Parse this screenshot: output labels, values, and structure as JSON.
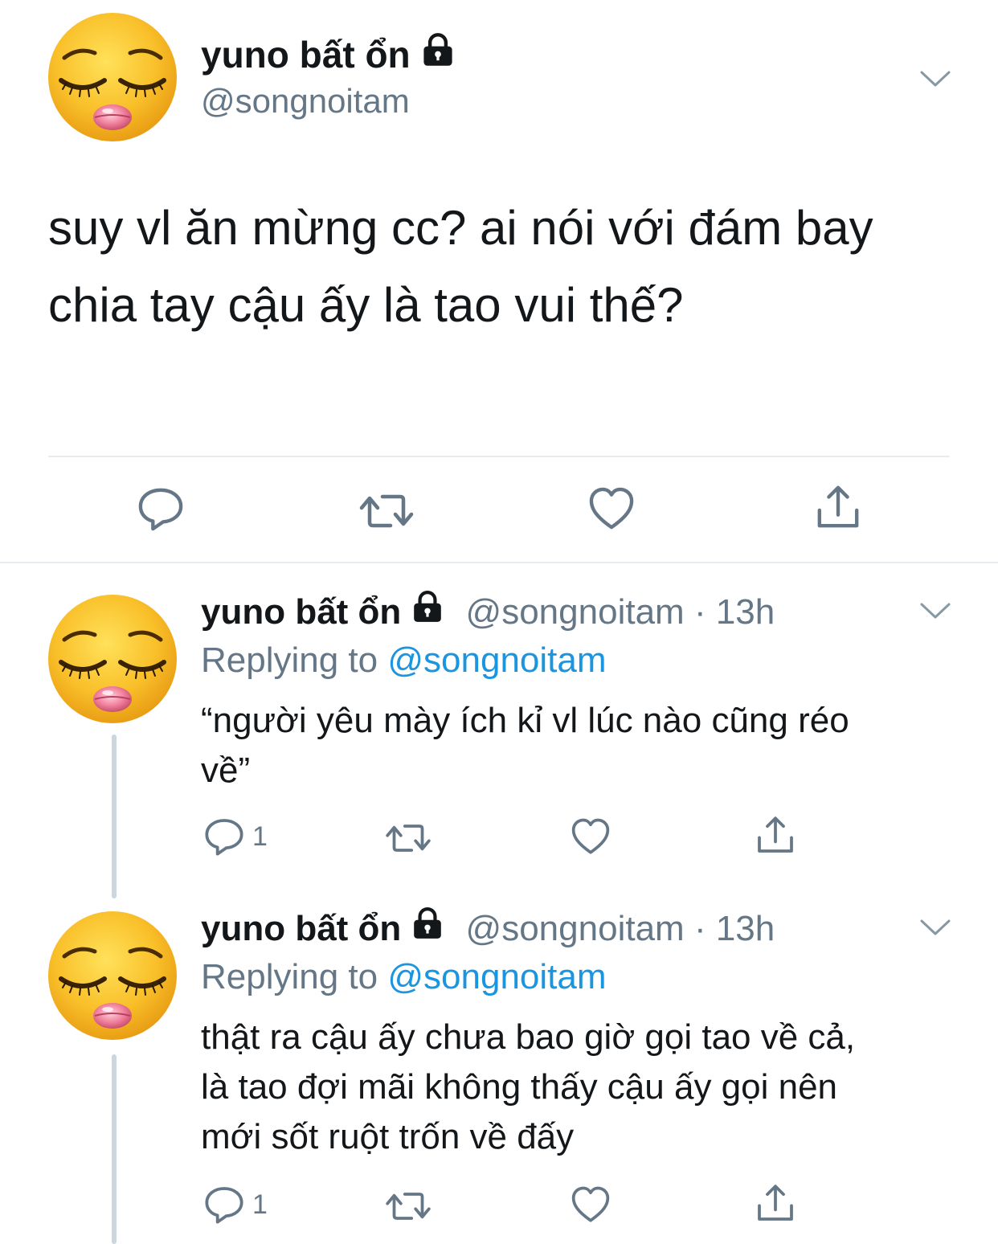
{
  "main_tweet": {
    "name": "yuno bất ổn",
    "handle": "@songnoitam",
    "text_line1": "suy vl ăn mừng cc? ai nói với đám bay",
    "text_line2": "chia tay cậu ấy là tao vui thế?"
  },
  "replies": [
    {
      "name": "yuno bất ổn",
      "handle": "@songnoitam",
      "separator": "·",
      "time": "13h",
      "replying_prefix": "Replying to",
      "replying_to": "@songnoitam",
      "text_line1": "“người yêu mày ích kỉ vl lúc nào cũng réo",
      "text_line2": "về”",
      "reply_count": "1"
    },
    {
      "name": "yuno bất ổn",
      "handle": "@songnoitam",
      "separator": "·",
      "time": "13h",
      "replying_prefix": "Replying to",
      "replying_to": "@songnoitam",
      "text_line1": "thật ra cậu ấy chưa bao giờ gọi tao về cả,",
      "text_line2": "là tao đợi mãi không thấy cậu ấy gọi nên",
      "text_line3": "mới sốt ruột trốn về đấy",
      "reply_count": "1"
    }
  ],
  "icons": {
    "avatar": "pensive-face-emoji",
    "lock": "lock-icon",
    "chevron": "chevron-down-icon",
    "reply": "reply-icon",
    "retweet": "retweet-icon",
    "like": "heart-icon",
    "share": "share-icon"
  },
  "colors": {
    "text": "#14171a",
    "muted": "#657786",
    "link": "#1b95e0",
    "divider": "#e6ecf0",
    "thread_line": "#ccd6dd"
  }
}
